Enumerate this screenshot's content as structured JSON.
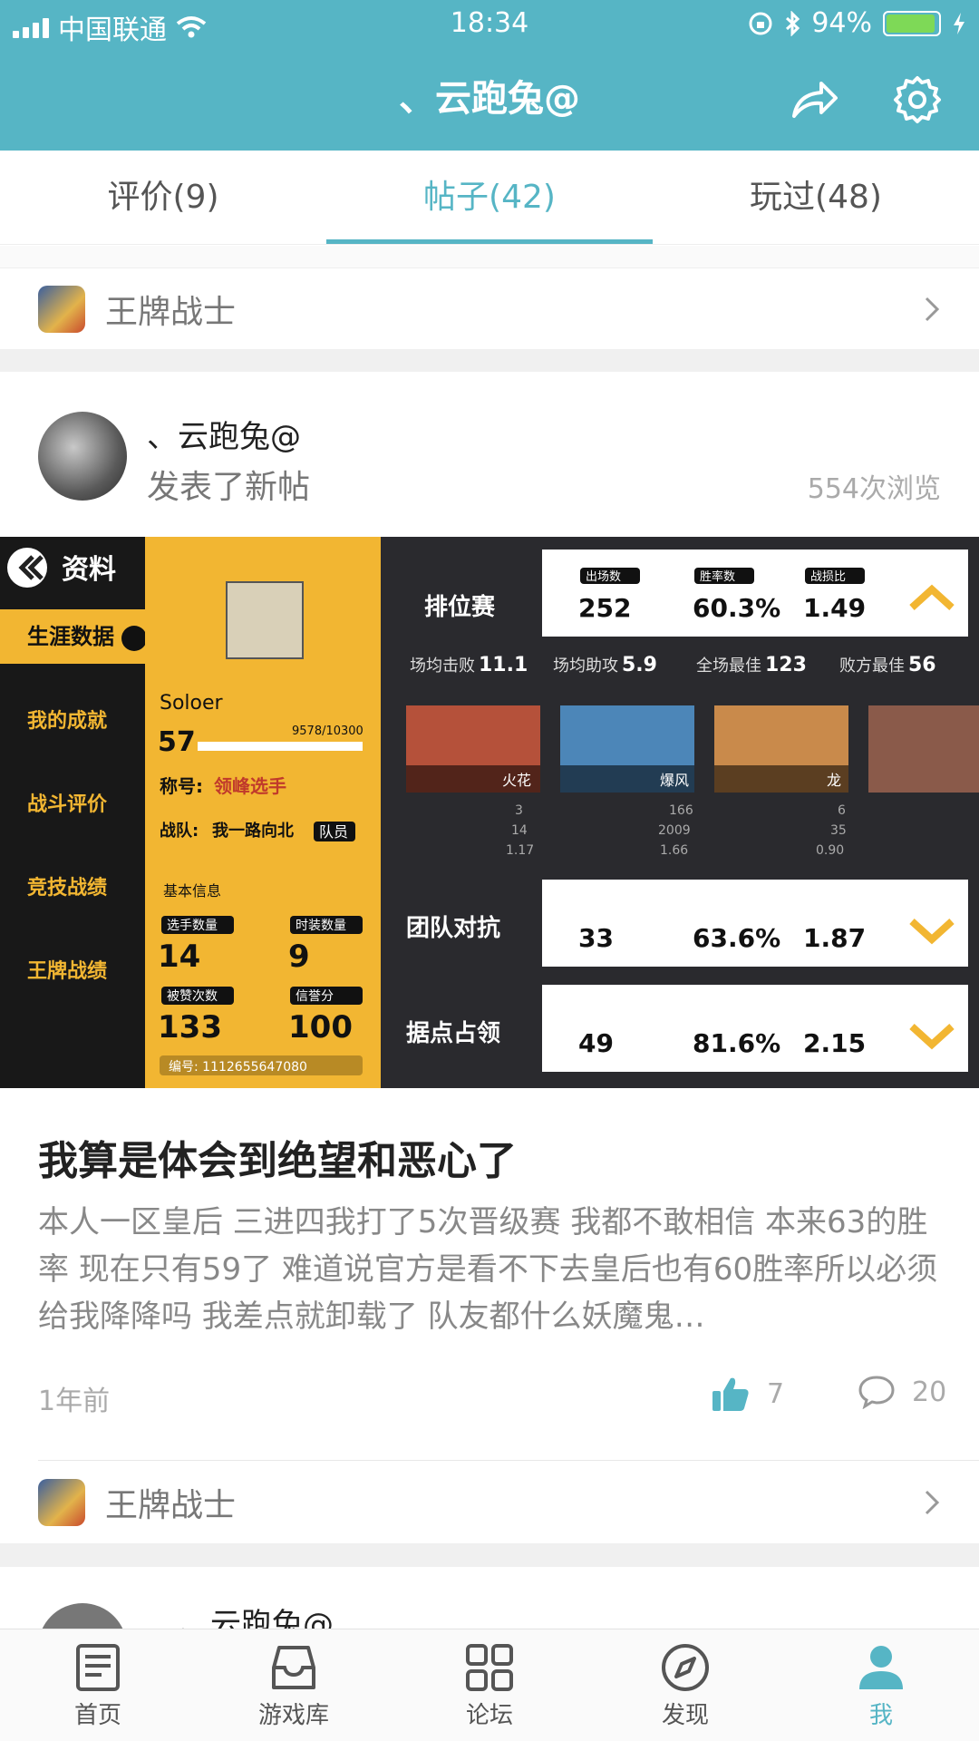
{
  "status_bar": {
    "carrier": "中国联通",
    "time": "18:34",
    "battery": "94%",
    "battery_level": 0.94
  },
  "header": {
    "title": "、云跑兔@"
  },
  "tabs": [
    {
      "label": "评价(9)"
    },
    {
      "label": "帖子(42)",
      "active": true
    },
    {
      "label": "玩过(48)"
    }
  ],
  "game_row_top": {
    "name": "王牌战士"
  },
  "post": {
    "author": "、云跑兔@",
    "action": "发表了新帖",
    "views": "554次浏览",
    "image": {
      "title": "资料",
      "menu": [
        "生涯数据",
        "我的成就",
        "战斗评价",
        "竞技战绩",
        "王牌战绩"
      ],
      "player_name": "Soloer",
      "level": "57",
      "exp": "9578/10300",
      "title_label": "称号:",
      "title_value": "领峰选手",
      "team_label": "战队:",
      "team_value": "我一路向北",
      "team_role": "队员",
      "basic_info": "基本信息",
      "stats": [
        {
          "label": "选手数量",
          "value": "14"
        },
        {
          "label": "时装数量",
          "value": "9"
        },
        {
          "label": "被赞次数",
          "value": "133"
        },
        {
          "label": "信誉分",
          "value": "100"
        }
      ],
      "player_id": "编号: 1112655647080",
      "modes": [
        {
          "name": "排位赛",
          "matches": "252",
          "winrate": "60.3%",
          "kd": "1.49"
        },
        {
          "name": "团队对抗",
          "matches": "33",
          "winrate": "63.6%",
          "kd": "1.87"
        },
        {
          "name": "据点占领",
          "matches": "49",
          "winrate": "81.6%",
          "kd": "2.15"
        }
      ],
      "col_labels": {
        "matches": "出场数",
        "winrate": "胜率数",
        "kd": "战损比"
      },
      "averages": [
        {
          "label": "场均击败",
          "value": "11.1"
        },
        {
          "label": "场均助攻",
          "value": "5.9"
        },
        {
          "label": "全场最佳",
          "value": "123"
        },
        {
          "label": "败方最佳",
          "value": "56"
        }
      ],
      "heroes": [
        {
          "name": "火花",
          "played": "3",
          "lost": "14",
          "kd": "1.17"
        },
        {
          "name": "爆风",
          "played": "166",
          "lost": "2009",
          "kd": "1.66"
        },
        {
          "name": "龙",
          "played": "6",
          "lost": "35",
          "kd": "0.90"
        }
      ]
    },
    "title": "我算是体会到绝望和恶心了",
    "body": "本人一区皇后 三进四我打了5次晋级赛 我都不敢相信 本来63的胜率 现在只有59了 难道说官方是看不下去皇后也有60胜率所以必须给我降降吗 我差点就卸载了 队友都什么妖魔鬼…",
    "time": "1年前",
    "likes": "7",
    "comments": "20"
  },
  "game_row_bottom": {
    "name": "王牌战士"
  },
  "post2": {
    "author": "、云跑兔@"
  },
  "bottom_nav": [
    {
      "label": "首页",
      "icon": "home-icon"
    },
    {
      "label": "游戏库",
      "icon": "inbox-icon"
    },
    {
      "label": "论坛",
      "icon": "grid-icon"
    },
    {
      "label": "发现",
      "icon": "compass-icon"
    },
    {
      "label": "我",
      "icon": "user-icon",
      "active": true
    }
  ],
  "colors": {
    "accent": "#56b5c5",
    "game_yellow": "#f2b632"
  }
}
